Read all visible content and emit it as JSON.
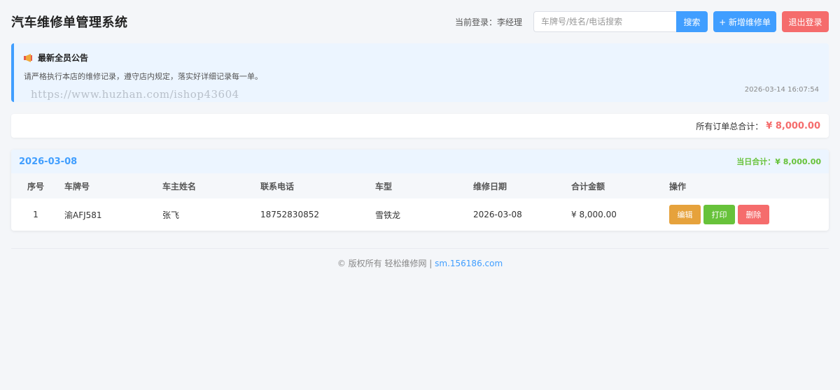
{
  "header": {
    "title": "汽车维修单管理系统",
    "login_label": "当前登录：李经理",
    "search_placeholder": "车牌号/姓名/电话搜索",
    "search_button": "搜索",
    "add_button": "+ 新增维修单",
    "logout_button": "退出登录"
  },
  "notice": {
    "icon": "megaphone-icon",
    "title": "最新全员公告",
    "content": "请严格执行本店的维修记录，遵守店内规定，落实好详细记录每一单。",
    "watermark": "https://www.huzhan.com/ishop43604",
    "time": "2026-03-14 16:07:54"
  },
  "summary": {
    "label": "所有订单总合计：",
    "amount": "¥ 8,000.00"
  },
  "days": [
    {
      "date": "2026-03-08",
      "total_label": "当日合计：¥ 8,000.00",
      "columns": [
        "序号",
        "车牌号",
        "车主姓名",
        "联系电话",
        "车型",
        "维修日期",
        "合计金额",
        "操作"
      ],
      "rows": [
        {
          "index": "1",
          "plate": "渝AFJ581",
          "owner": "张飞",
          "phone": "18752830852",
          "model": "雪铁龙",
          "date": "2026-03-08",
          "amount": "¥ 8,000.00",
          "actions": {
            "edit": "编辑",
            "print": "打印",
            "delete": "删除"
          }
        }
      ]
    }
  ],
  "footer": {
    "copyright": "© 版权所有 轻松维修网 | ",
    "link": "sm.156186.com"
  },
  "colors": {
    "primary": "#409eff",
    "danger": "#f56c6c",
    "success": "#67c23a",
    "warning": "#e6a23c"
  }
}
